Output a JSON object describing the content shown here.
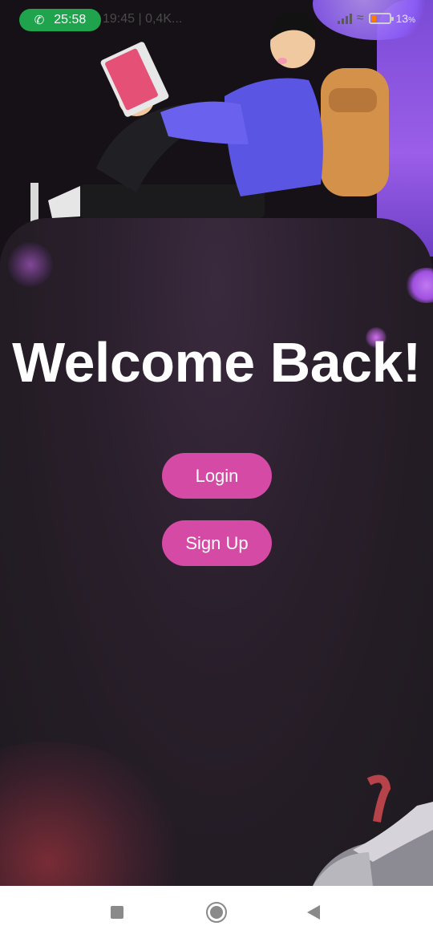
{
  "status_bar": {
    "call_timer": "25:58",
    "time_and_speed": "19:45 | 0,4K...",
    "battery_percent": "13",
    "battery_unit": "%",
    "icons": [
      "phone-icon",
      "signal-icon",
      "wifi-icon",
      "battery-icon"
    ]
  },
  "main": {
    "title": "Welcome Back!",
    "login_label": "Login",
    "signup_label": "Sign Up"
  },
  "nav_bar": {
    "icons": [
      "recent-apps-icon",
      "home-icon",
      "back-icon"
    ]
  },
  "colors": {
    "button": "#d54aa4",
    "background": "#231c24",
    "accent_purple": "#8b5cf6",
    "call_pill": "#1fa34d"
  }
}
